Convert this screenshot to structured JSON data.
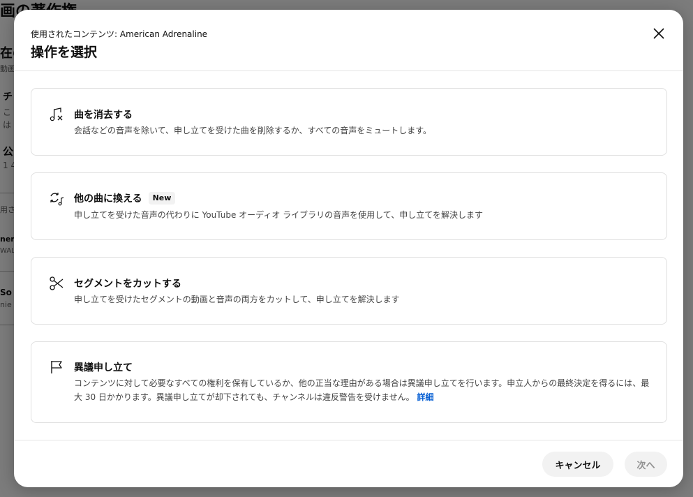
{
  "background": {
    "title": "画の著作権",
    "section": "在の",
    "section_sub": "動画",
    "item1_title": "チ",
    "item1_line1": "こ",
    "item1_line2": "は",
    "item2_title": "公",
    "item2_line1": "1 4",
    "label": "用さ",
    "row1_title": "neric",
    "row1_sub": "WAL",
    "row2_title": "So",
    "row2_sub": "nie"
  },
  "dialog": {
    "subtitle": "使用されたコンテンツ: American Adrenaline",
    "title": "操作を選択",
    "close_icon": "close-icon",
    "options": [
      {
        "icon": "music-note-remove-icon",
        "title": "曲を消去する",
        "description": "会話などの音声を除いて、申し立てを受けた曲を削除するか、すべての音声をミュートします。"
      },
      {
        "icon": "music-swap-icon",
        "title": "他の曲に換える",
        "badge": "New",
        "description": "申し立てを受けた音声の代わりに YouTube オーディオ ライブラリの音声を使用して、申し立てを解決します"
      },
      {
        "icon": "scissors-icon",
        "title": "セグメントをカットする",
        "description": "申し立てを受けたセグメントの動画と音声の両方をカットして、申し立てを解決します"
      },
      {
        "icon": "flag-icon",
        "title": "異議申し立て",
        "description": "コンテンツに対して必要なすべての権利を保有しているか、他の正当な理由がある場合は異議申し立てを行います。申立人からの最終決定を得るには、最大 30 日かかります。異議申し立てが却下されても、チャンネルは違反警告を受けません。",
        "link": "詳細"
      }
    ],
    "cancel_label": "キャンセル",
    "next_label": "次へ"
  },
  "colors": {
    "link": "#065fd4",
    "overlay": "#7f7f7f"
  }
}
